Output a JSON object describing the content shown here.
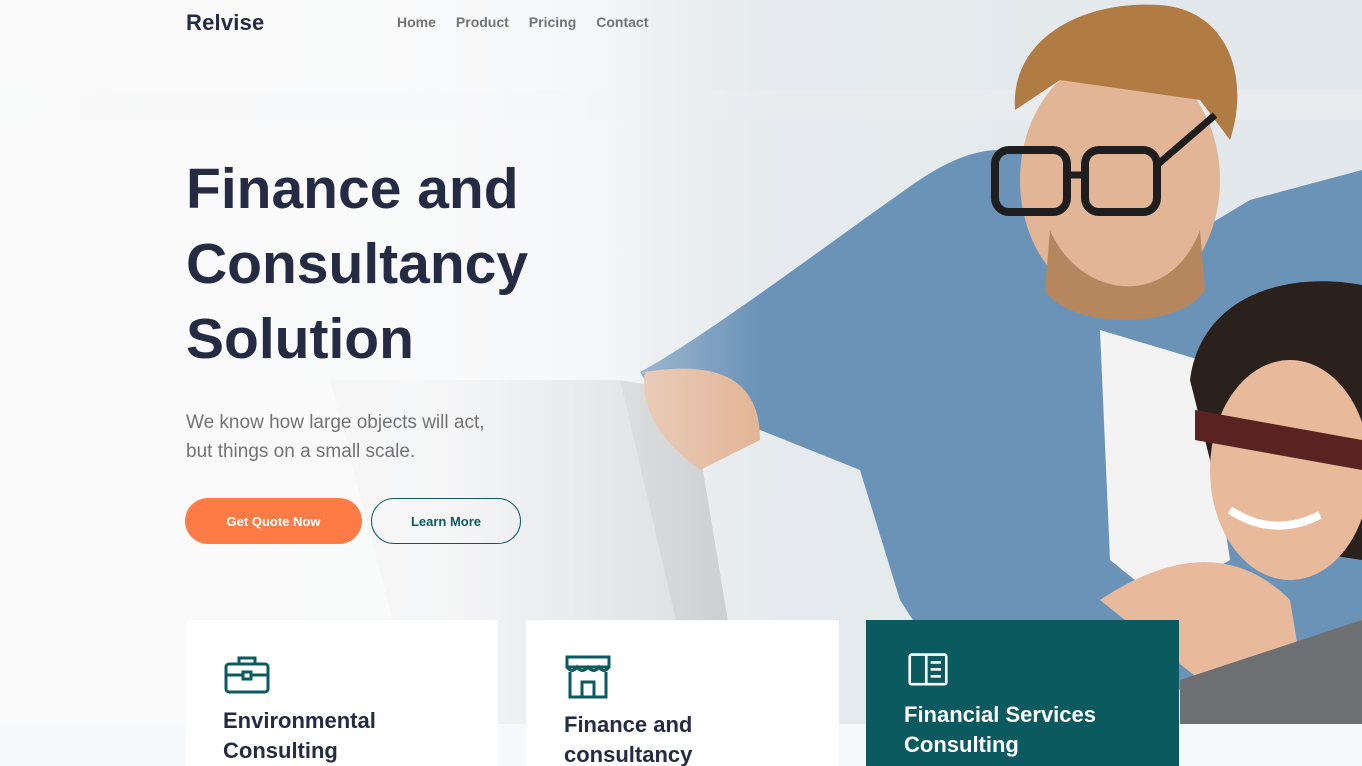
{
  "header": {
    "brand": "Relvise",
    "nav": [
      "Home",
      "Product",
      "Pricing",
      "Contact"
    ]
  },
  "hero": {
    "title_lines": [
      "Finance and",
      "Consultancy",
      "Solution"
    ],
    "subtitle_lines": [
      "We know how large objects will act,",
      "but things on a small scale."
    ],
    "primary_button": "Get Quote Now",
    "secondary_button": "Learn More"
  },
  "cards": [
    {
      "icon": "briefcase-icon",
      "title_lines": [
        "Environmental",
        "Consulting"
      ]
    },
    {
      "icon": "storefront-icon",
      "title_lines": [
        "Finance and",
        "consultancy"
      ]
    },
    {
      "icon": "open-book-icon",
      "title_lines": [
        "Financial Services",
        "Consulting"
      ]
    }
  ],
  "colors": {
    "heading": "#252b42",
    "muted_text": "#737373",
    "accent_orange": "#ff7b45",
    "brand_teal": "#0b5a60"
  }
}
